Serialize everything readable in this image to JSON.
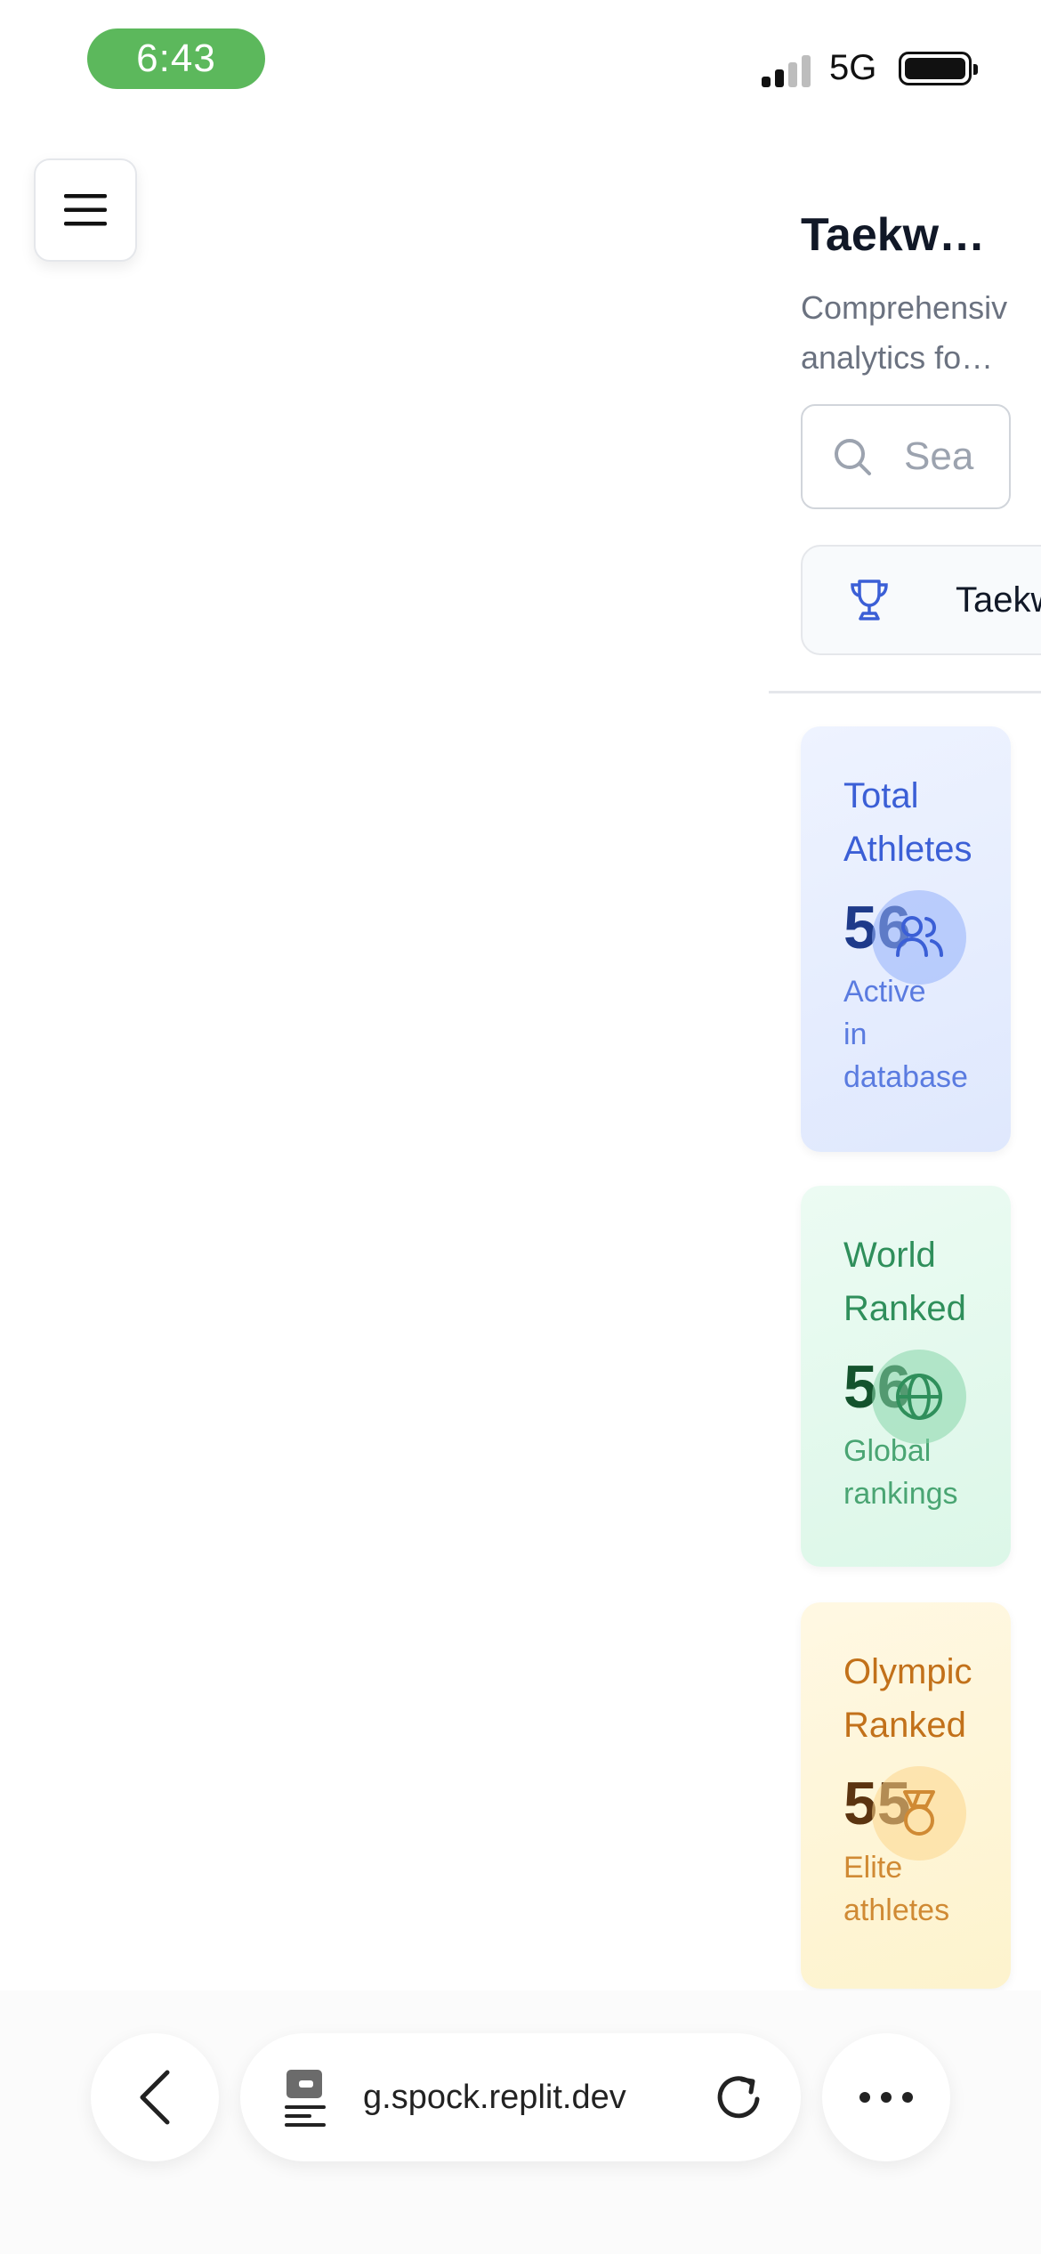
{
  "status_bar": {
    "time": "6:43",
    "network": "5G",
    "signal_bars": 4,
    "signal_active": 2,
    "battery_level": 1.0
  },
  "colors": {
    "time_pill": "#5cb85c",
    "blue_card": "#dfe8fd",
    "green_card": "#dcf7e8",
    "yellow_card": "#fdf3cd"
  },
  "menu": {
    "icon": "hamburger-icon"
  },
  "header": {
    "title": "Taekw…",
    "subtitle_line1": "Comprehensiv",
    "subtitle_line2": "analytics fo…"
  },
  "search": {
    "placeholder": "Sea",
    "icon": "search-icon"
  },
  "tabs": [
    {
      "label": "Taekw",
      "icon": "trophy-icon"
    }
  ],
  "cards": [
    {
      "title_line1": "Total",
      "title_line2": "Athletes",
      "value": "56",
      "sub_line1": "Active",
      "sub_line2": "in",
      "sub_line3": "database",
      "icon": "users-icon"
    },
    {
      "title_line1": "World",
      "title_line2": "Ranked",
      "value": "56",
      "sub_line1": "Global",
      "sub_line2": "rankings",
      "icon": "globe-icon"
    },
    {
      "title_line1": "Olympic",
      "title_line2": "Ranked",
      "value": "55",
      "sub_line1": "Elite",
      "sub_line2": "athletes",
      "icon": "medal-icon"
    }
  ],
  "browser": {
    "url": "g.spock.replit.dev",
    "back_icon": "chevron-left-icon",
    "more_icon": "more-icon",
    "reload_icon": "reload-icon",
    "site_icon": "extension-icon"
  }
}
